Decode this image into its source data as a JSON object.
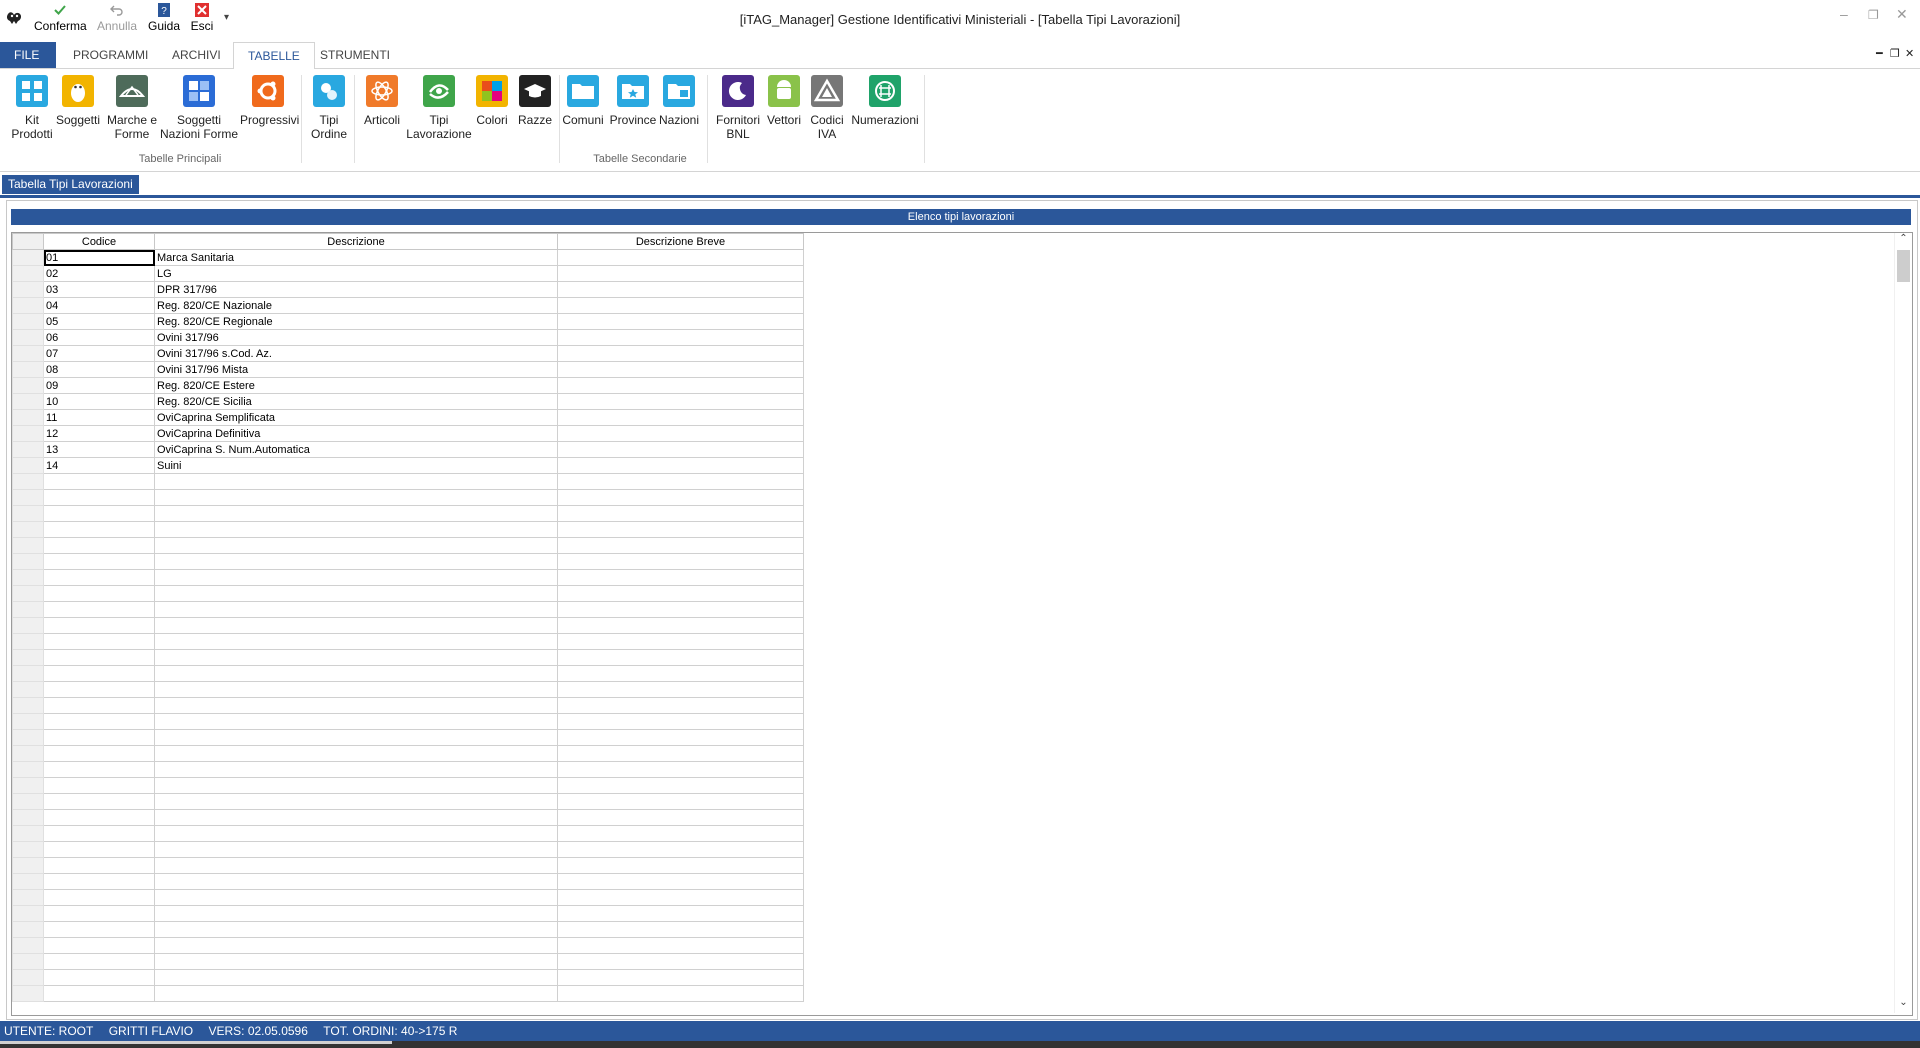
{
  "titlebar": {
    "window_title": "[iTAG_Manager] Gestione Identificativi Ministeriali - [Tabella Tipi Lavorazioni]",
    "qat": [
      {
        "label": "Conferma",
        "icon": "check-icon",
        "enabled": true
      },
      {
        "label": "Annulla",
        "icon": "undo-icon",
        "enabled": false
      },
      {
        "label": "Guida",
        "icon": "help-icon",
        "enabled": true
      },
      {
        "label": "Esci",
        "icon": "exit-icon",
        "enabled": true
      }
    ]
  },
  "tabs": [
    {
      "label": "FILE"
    },
    {
      "label": "PROGRAMMI"
    },
    {
      "label": "ARCHIVI"
    },
    {
      "label": "TABELLE"
    },
    {
      "label": "STRUMENTI"
    }
  ],
  "ribbon": {
    "groups": [
      {
        "label": "Tabelle Principali"
      },
      {
        "label": "Tabelle Secondarie"
      }
    ],
    "buttons": [
      {
        "label": "Kit\nProdotti",
        "icon": "kit-products-icon",
        "color": "#29a8e0"
      },
      {
        "label": "Soggetti",
        "icon": "linux-icon",
        "color": "#f2b400"
      },
      {
        "label": "Marche e\nForme",
        "icon": "shapes-icon",
        "color": "#4e6b5a"
      },
      {
        "label": "Soggetti\nNazioni Forme",
        "icon": "grid-icon",
        "color": "#2b6cd6"
      },
      {
        "label": "Progressivi",
        "icon": "ubuntu-icon",
        "color": "#f06a1c"
      },
      {
        "label": "Tipi\nOrdine",
        "icon": "notes-icon",
        "color": "#29a8e0"
      },
      {
        "label": "Articoli",
        "icon": "atom-icon",
        "color": "#f07a2a"
      },
      {
        "label": "Tipi\nLavorazione",
        "icon": "processing-icon",
        "color": "#3fa54a"
      },
      {
        "label": "Colori",
        "icon": "palette-icon",
        "color": "#f2b400"
      },
      {
        "label": "Razze",
        "icon": "graduation-cap-icon",
        "color": "#222222"
      },
      {
        "label": "Comuni",
        "icon": "folder-icon",
        "color": "#29a8e0"
      },
      {
        "label": "Province",
        "icon": "folder-star-icon",
        "color": "#29a8e0"
      },
      {
        "label": "Nazioni",
        "icon": "folder-open-icon",
        "color": "#29a8e0"
      },
      {
        "label": "Fornitori\nBNL",
        "icon": "moon-icon",
        "color": "#4b2a8a"
      },
      {
        "label": "Vettori",
        "icon": "android-icon",
        "color": "#8ac24a"
      },
      {
        "label": "Codici\nIVA",
        "icon": "triangle-icon",
        "color": "#777777"
      },
      {
        "label": "Numerazioni",
        "icon": "network-icon",
        "color": "#1fa36a"
      }
    ]
  },
  "document_tab": {
    "label": "Tabella Tipi Lavorazioni"
  },
  "grid": {
    "title": "Elenco tipi lavorazioni",
    "columns": [
      "Codice",
      "Descrizione",
      "Descrizione Breve"
    ],
    "rows": [
      [
        "01",
        "Marca Sanitaria",
        ""
      ],
      [
        "02",
        "LG",
        ""
      ],
      [
        "03",
        "DPR 317/96",
        ""
      ],
      [
        "04",
        "Reg. 820/CE Nazionale",
        ""
      ],
      [
        "05",
        "Reg. 820/CE Regionale",
        ""
      ],
      [
        "06",
        "Ovini 317/96",
        ""
      ],
      [
        "07",
        "Ovini 317/96 s.Cod. Az.",
        ""
      ],
      [
        "08",
        "Ovini 317/96 Mista",
        ""
      ],
      [
        "09",
        "Reg. 820/CE Estere",
        ""
      ],
      [
        "10",
        "Reg. 820/CE Sicilia",
        ""
      ],
      [
        "11",
        "OviCaprina Semplificata",
        ""
      ],
      [
        "12",
        "OviCaprina Definitiva",
        ""
      ],
      [
        "13",
        "OviCaprina S. Num.Automatica",
        ""
      ],
      [
        "14",
        "Suini",
        ""
      ]
    ]
  },
  "status": {
    "user": "UTENTE: ROOT",
    "name": "GRITTI FLAVIO",
    "version": "VERS: 02.05.0596",
    "orders": "TOT. ORDINI: 40->175 R"
  }
}
